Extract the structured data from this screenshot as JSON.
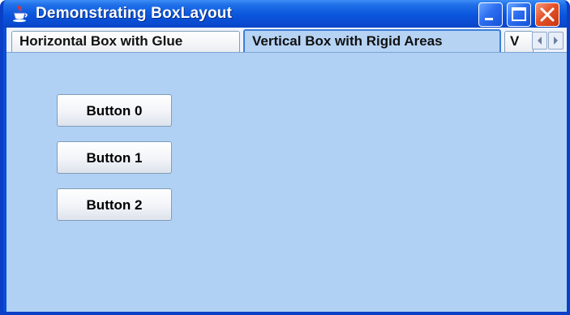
{
  "window": {
    "title": "Demonstrating BoxLayout",
    "app_icon": "java-cup-icon",
    "controls": [
      "minimize-icon",
      "maximize-icon",
      "close-icon"
    ]
  },
  "tabs": [
    {
      "label": "Horizontal Box with Glue",
      "selected": false
    },
    {
      "label": "Vertical Box with Rigid Areas",
      "selected": true
    },
    {
      "label": "V",
      "selected": false
    }
  ],
  "tab_scroll": [
    "chevron-left-icon",
    "chevron-right-icon"
  ],
  "panel": {
    "buttons": [
      {
        "label": "Button 0"
      },
      {
        "label": "Button 1"
      },
      {
        "label": "Button 2"
      }
    ]
  },
  "colors": {
    "titlebar": "#0a55dc",
    "panel": "#b0d1f3",
    "close_button": "#e4522a"
  }
}
